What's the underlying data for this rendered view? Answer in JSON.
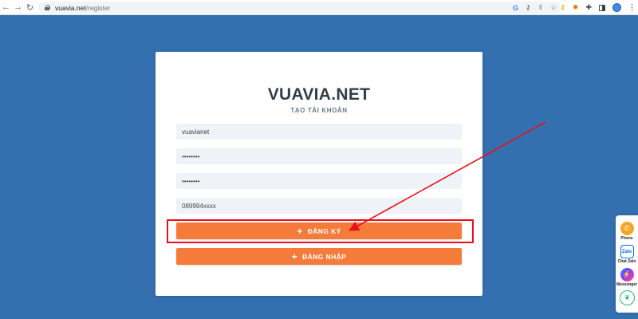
{
  "browser": {
    "url_host": "vuavia.net",
    "url_path": "/register",
    "icons": [
      "back-icon",
      "forward-icon",
      "reload-icon",
      "lock-icon",
      "google-icon",
      "key-icon",
      "share-icon",
      "star-icon",
      "extension-key-icon",
      "extension-gear-icon",
      "puzzle-icon",
      "side-panel-icon",
      "profile-icon",
      "more-icon"
    ]
  },
  "card": {
    "brand": "VUAVIA.NET",
    "subtitle": "TẠO TÀI KHOẢN",
    "fields": {
      "username": "vuavianet",
      "password": "••••••••",
      "confirm_password": "••••••••",
      "phone": "089994xxxx"
    },
    "register_label": "ĐĂNG KÝ",
    "login_label": "ĐĂNG NHẬP"
  },
  "contact": {
    "phone_label": "Phone",
    "zalo_label": "Chat Zalo",
    "zalo_icon_text": "Zalo",
    "messenger_label": "Messenger"
  },
  "colors": {
    "background": "#3470b0",
    "accent_button": "#f47b3a",
    "annotation": "#e8101a"
  }
}
